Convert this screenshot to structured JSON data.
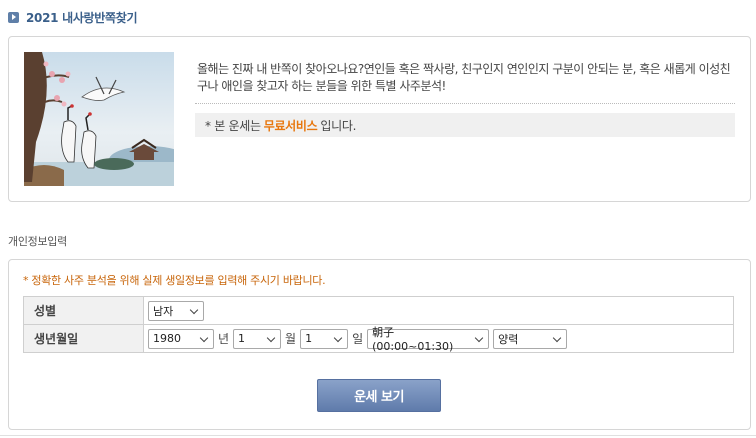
{
  "page": {
    "title": "2021 내사랑반쪽찾기"
  },
  "intro": {
    "image_icon": "cranes-illustration",
    "description": "올해는 진짜 내 반쪽이 찾아오나요?연인들 혹은 짝사랑, 친구인지 연인인지 구분이 안되는 분, 혹은 새롭게 이성친구나 애인을 찾고자 하는 분들을 위한 특별 사주분석!",
    "notice_prefix": "* 본 운세는",
    "notice_highlight": "무료서비스",
    "notice_suffix": "입니다."
  },
  "section": {
    "title": "개인정보입력"
  },
  "form": {
    "notice": "* 정확한 사주 분석을 위해 실제 생일정보를 입력해 주시기 바랍니다.",
    "gender": {
      "label": "성별",
      "value": "남자"
    },
    "birth": {
      "label": "생년월일",
      "year": "1980",
      "year_unit": "년",
      "month": "1",
      "month_unit": "월",
      "day": "1",
      "day_unit": "일",
      "time": "朝子(00:00~01:30)",
      "calendar": "양력"
    },
    "submit_label": "운세 보기"
  },
  "colors": {
    "title": "#3a5f8a",
    "highlight": "#e8770e",
    "notice": "#c8650a",
    "button": "#6f89b6"
  }
}
